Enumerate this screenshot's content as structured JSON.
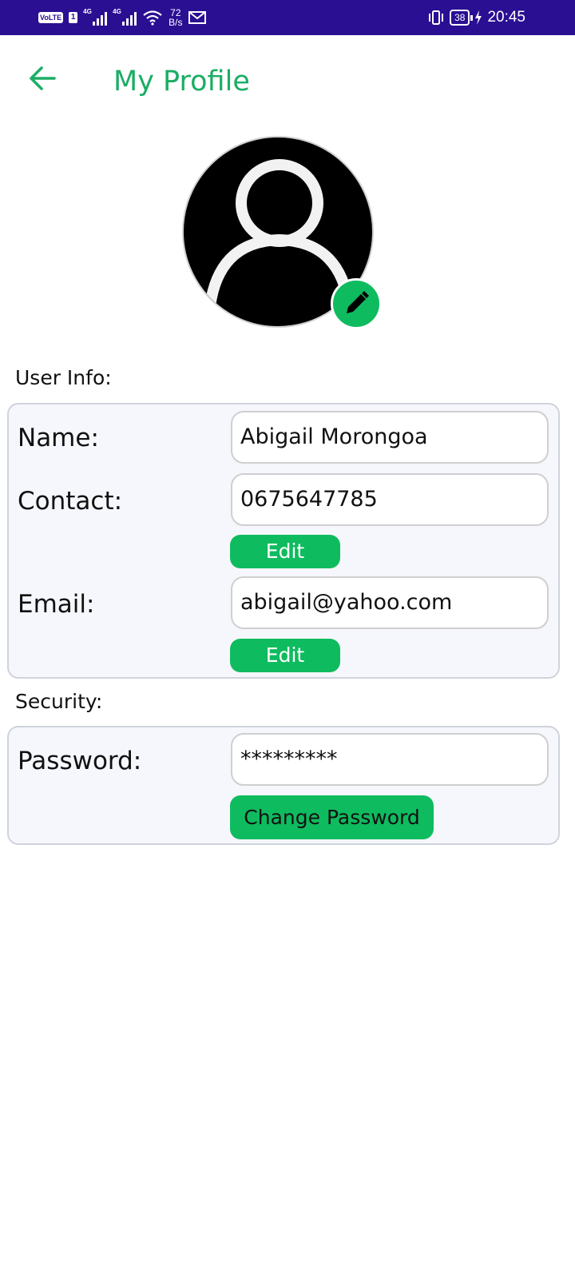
{
  "status_bar": {
    "volte": "VoLTE",
    "sim": "1",
    "network_1": "4G",
    "network_2": "4G",
    "net_speed_value": "72",
    "net_speed_unit": "B/s",
    "battery": "38",
    "time": "20:45"
  },
  "header": {
    "title": "My Profile"
  },
  "user_info": {
    "section_label": "User Info:",
    "name_label": "Name:",
    "name_value": "Abigail Morongoa",
    "contact_label": "Contact:",
    "contact_value": "0675647785",
    "contact_edit_label": "Edit",
    "email_label": "Email:",
    "email_value": "abigail@yahoo.com",
    "email_edit_label": "Edit"
  },
  "security": {
    "section_label": "Security:",
    "password_label": "Password:",
    "password_value": "*********",
    "change_password_label": "Change Password"
  },
  "colors": {
    "status_bar": "#2a0f93",
    "accent": "#1cad65",
    "button": "#0fbb5f",
    "card_bg": "#f5f7fc"
  },
  "icons": [
    "back-arrow-icon",
    "user-icon",
    "pencil-icon",
    "wifi-icon",
    "mail-icon",
    "vibrate-icon",
    "charging-icon"
  ]
}
